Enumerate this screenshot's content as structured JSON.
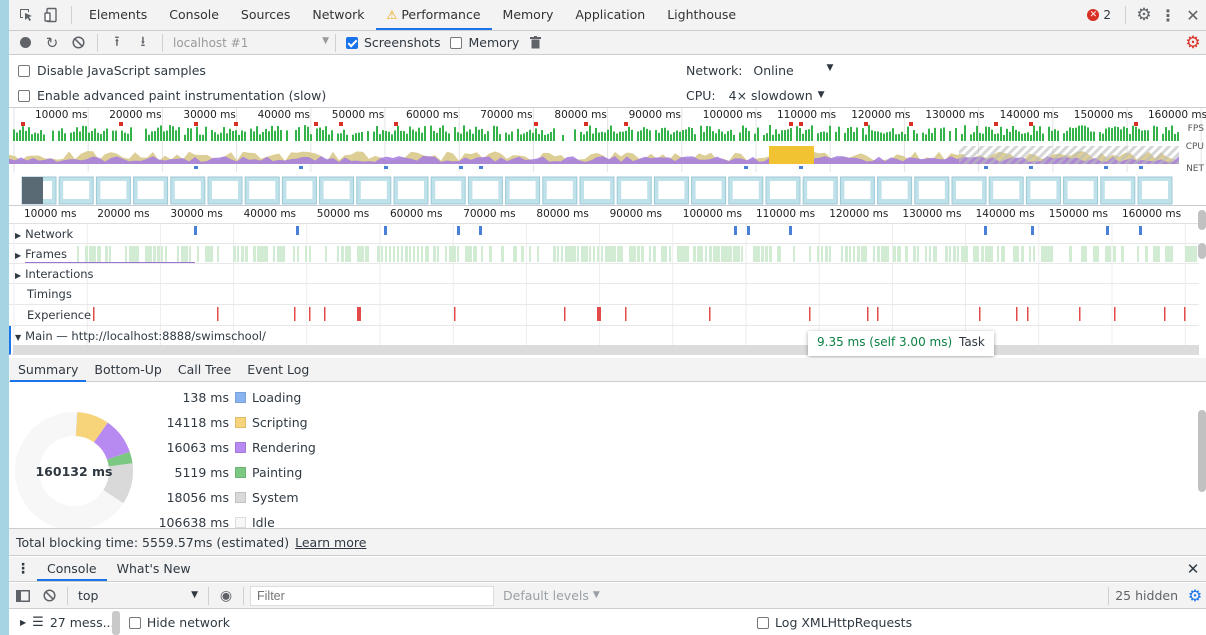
{
  "main_tabs": [
    "Elements",
    "Console",
    "Sources",
    "Network",
    "Performance",
    "Memory",
    "Application",
    "Lighthouse"
  ],
  "active_main_tab": "Performance",
  "error_count": "2",
  "toolbar": {
    "profile_select": "localhost #1",
    "screenshots_label": "Screenshots",
    "screenshots_checked": true,
    "memory_label": "Memory",
    "memory_checked": false
  },
  "settings": {
    "disable_js_samples": "Disable JavaScript samples",
    "advanced_paint": "Enable advanced paint instrumentation (slow)",
    "network_label": "Network:",
    "network_value": "Online",
    "cpu_label": "CPU:",
    "cpu_value": "4× slowdown"
  },
  "overview": {
    "ticks": [
      "10000 ms",
      "20000 ms",
      "30000 ms",
      "40000 ms",
      "50000 ms",
      "60000 ms",
      "70000 ms",
      "80000 ms",
      "90000 ms",
      "100000 ms",
      "110000 ms",
      "120000 ms",
      "130000 ms",
      "140000 ms",
      "150000 ms",
      "160000 ms"
    ],
    "lane_labels": [
      "FPS",
      "CPU",
      "NET"
    ]
  },
  "timeline": {
    "ticks": [
      "10000 ms",
      "20000 ms",
      "30000 ms",
      "40000 ms",
      "50000 ms",
      "60000 ms",
      "70000 ms",
      "80000 ms",
      "90000 ms",
      "100000 ms",
      "110000 ms",
      "120000 ms",
      "130000 ms",
      "140000 ms",
      "150000 ms",
      "160000 ms"
    ],
    "tracks": [
      "Network",
      "Frames",
      "Interactions",
      "Timings",
      "Experience"
    ],
    "main_label": "Main — http://localhost:8888/swimschool/"
  },
  "tooltip": {
    "time": "9.35 ms (self 3.00 ms)",
    "name": "Task"
  },
  "detail_tabs": [
    "Summary",
    "Bottom-Up",
    "Call Tree",
    "Event Log"
  ],
  "active_detail_tab": "Summary",
  "summary": {
    "total": "160132 ms",
    "categories": [
      {
        "value": "138 ms",
        "name": "Loading",
        "color": "#8ab4f0"
      },
      {
        "value": "14118 ms",
        "name": "Scripting",
        "color": "#f7d37a"
      },
      {
        "value": "16063 ms",
        "name": "Rendering",
        "color": "#b68af0"
      },
      {
        "value": "5119 ms",
        "name": "Painting",
        "color": "#7bc883"
      },
      {
        "value": "18056 ms",
        "name": "System",
        "color": "#d9d9d9"
      },
      {
        "value": "106638 ms",
        "name": "Idle",
        "color": "#f7f7f7"
      }
    ],
    "total_blocking_label": "Total blocking time: 5559.57ms (estimated)",
    "learn_more": "Learn more"
  },
  "drawer": {
    "tabs": [
      "Console",
      "What's New"
    ],
    "context": "top",
    "filter_placeholder": "Filter",
    "levels": "Default levels",
    "hidden": "25 hidden",
    "messages": "27 mess...",
    "hide_network": "Hide network",
    "log_xhr": "Log XMLHttpRequests"
  }
}
